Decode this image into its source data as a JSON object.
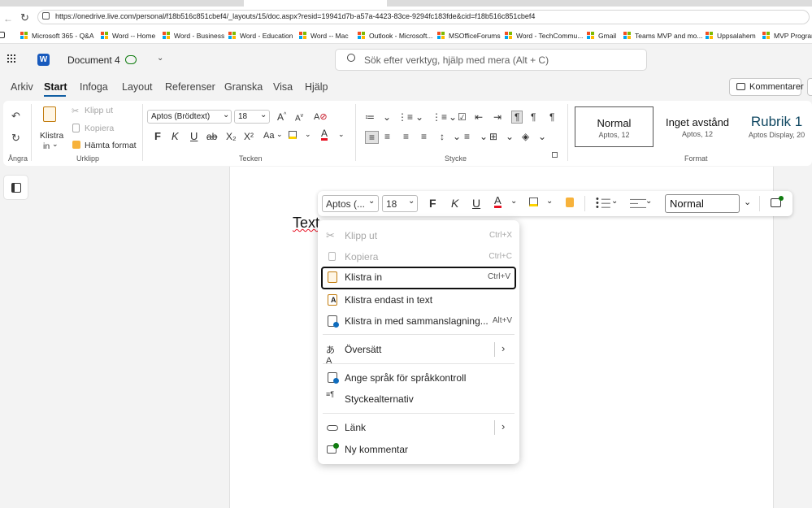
{
  "browser": {
    "url": "https://onedrive.live.com/personal/f18b516c851cbef4/_layouts/15/doc.aspx?resid=19941d7b-a57a-4423-83ce-9294fc183fde&cid=f18b516c851cbef4",
    "bookmarks": [
      "Microsoft 365 - Q&A",
      "Word -- Home",
      "Word - Business",
      "Word - Education",
      "Word -- Mac",
      "Outlook - Microsoft...",
      "MSOfficeForums",
      "Word - TechCommu...",
      "Gmail",
      "Teams MVP and mo...",
      "Uppsalahem",
      "MVP Program"
    ]
  },
  "app": {
    "doc_title": "Document 4",
    "search_placeholder": "Sök efter verktyg, hjälp med mera (Alt + C)",
    "comments_button": "Kommentarer"
  },
  "tabs": [
    "Arkiv",
    "Start",
    "Infoga",
    "Layout",
    "Referenser",
    "Granska",
    "Visa",
    "Hjälp"
  ],
  "active_tab": "Start",
  "ribbon": {
    "undo_group": "Ångra",
    "clipboard": {
      "paste": "Klistra",
      "paste2": "in",
      "cut": "Klipp ut",
      "copy": "Kopiera",
      "format_painter": "Hämta format",
      "group": "Urklipp"
    },
    "font": {
      "name": "Aptos (Brödtext)",
      "size": "18",
      "bold": "F",
      "italic": "K",
      "underline": "U",
      "strike": "ab",
      "sub": "X₂",
      "sup": "X²",
      "case": "Aa",
      "group": "Tecken"
    },
    "paragraph": {
      "group": "Stycke"
    },
    "styles": {
      "group": "Format",
      "items": [
        {
          "name": "Normal",
          "sub": "Aptos, 12"
        },
        {
          "name": "Inget avstånd",
          "sub": "Aptos, 12"
        },
        {
          "name": "Rubrik 1",
          "sub": "Aptos Display, 20"
        }
      ]
    }
  },
  "document": {
    "text": "Text"
  },
  "mini_toolbar": {
    "font": "Aptos (...",
    "size": "18",
    "bold": "F",
    "italic": "K",
    "underline": "U",
    "style": "Normal"
  },
  "context_menu": [
    {
      "label": "Klipp ut",
      "shortcut": "Ctrl+X",
      "disabled": true
    },
    {
      "label": "Kopiera",
      "shortcut": "Ctrl+C",
      "disabled": true
    },
    {
      "label": "Klistra in",
      "shortcut": "Ctrl+V",
      "focused": true
    },
    {
      "label": "Klistra endast in text",
      "shortcut": ""
    },
    {
      "label": "Klistra in med sammanslagning...",
      "shortcut": "Alt+V"
    },
    {
      "label": "Översätt",
      "submenu": true
    },
    {
      "label": "Ange språk för språkkontroll"
    },
    {
      "label": "Styckealternativ"
    },
    {
      "label": "Länk",
      "submenu": true
    },
    {
      "label": "Ny kommentar"
    }
  ],
  "colors": {
    "accent": "#115ea3",
    "font_red": "#e81123",
    "highlight_yellow": "#ffd400",
    "word_blue": "#185abd"
  }
}
